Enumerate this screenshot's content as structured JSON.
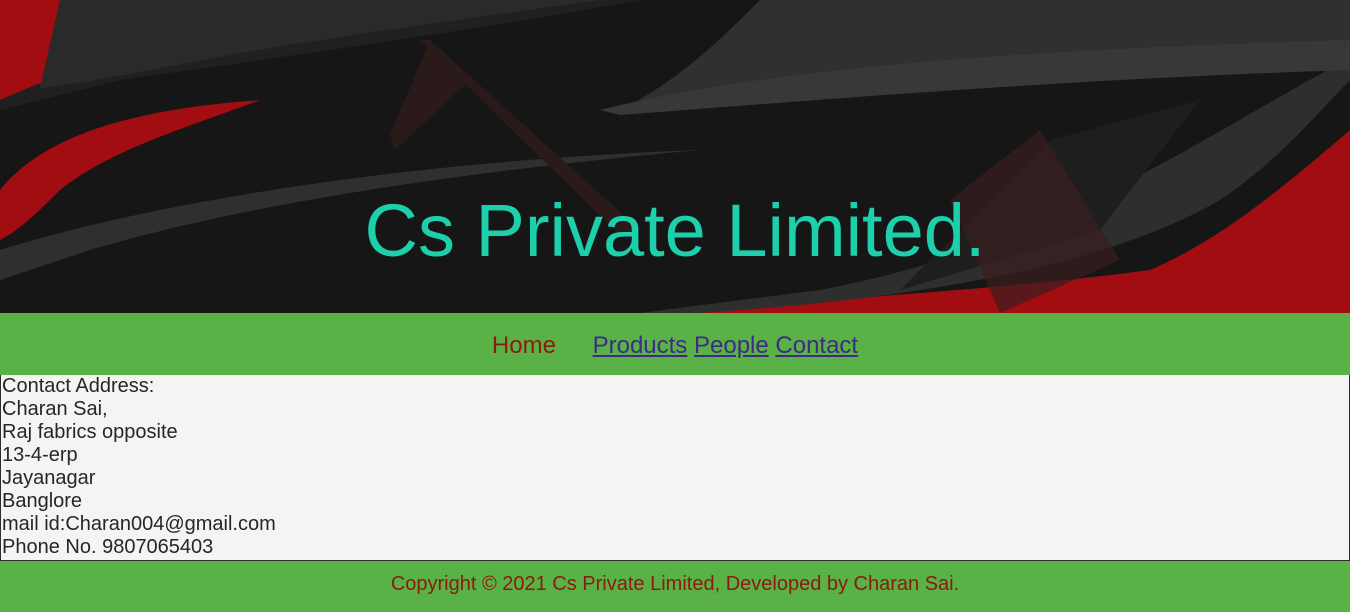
{
  "banner": {
    "title": "Cs Private Limited."
  },
  "nav": {
    "items": [
      {
        "label": "Home"
      },
      {
        "label": "Products"
      },
      {
        "label": "People"
      },
      {
        "label": "Contact"
      }
    ]
  },
  "contact": {
    "lines": [
      "Contact Address:",
      "Charan Sai,",
      "Raj fabrics opposite",
      "13-4-erp",
      "Jayanagar",
      "Banglore",
      "mail id:Charan004@gmail.com",
      "Phone No. 9807065403"
    ]
  },
  "footer": {
    "text": "Copyright © 2021 Cs Private Limited, Developed by Charan Sai."
  },
  "colors": {
    "title": "#1ecfab",
    "nav_bg": "#5ab146",
    "link": "#3d2a8a",
    "home_link": "#8b1a10",
    "footer_text": "#8b1a10",
    "banner_dark": "#1a1a1a",
    "banner_red": "#a10d10"
  }
}
